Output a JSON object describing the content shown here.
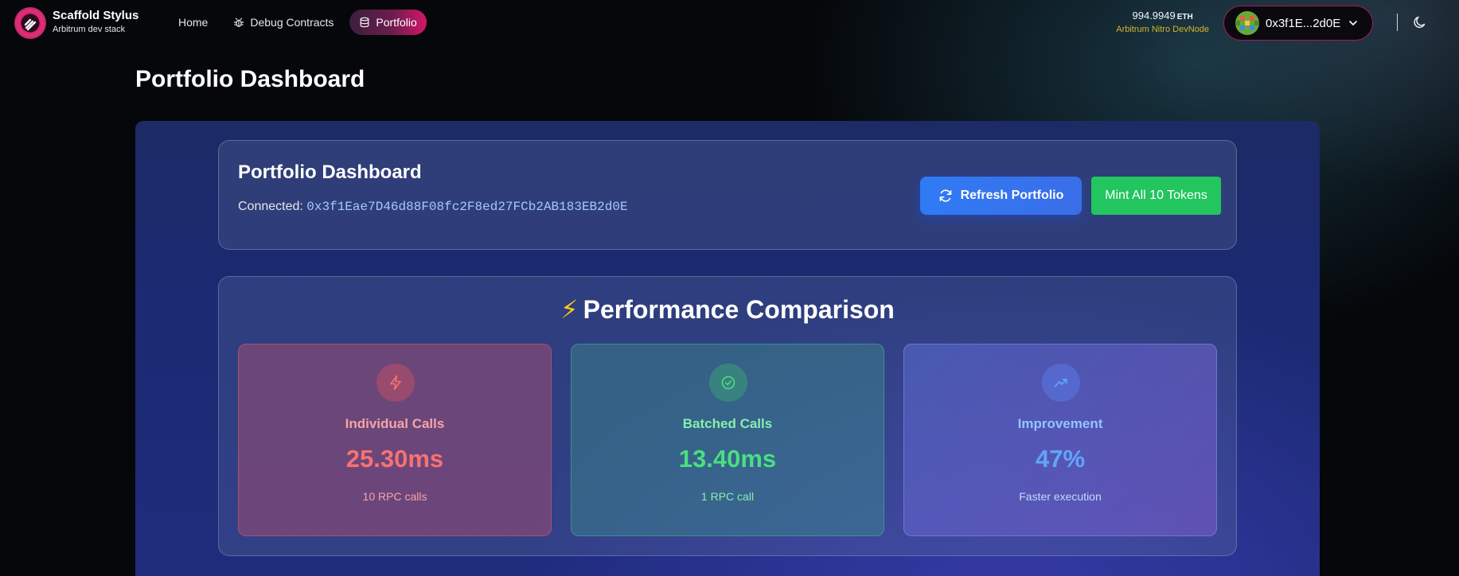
{
  "brand": {
    "title": "Scaffold Stylus",
    "subtitle": "Arbitrum dev stack"
  },
  "nav": [
    {
      "label": "Home",
      "icon": "none"
    },
    {
      "label": "Debug Contracts",
      "icon": "bug-icon"
    },
    {
      "label": "Portfolio",
      "icon": "database-icon",
      "active": true
    }
  ],
  "wallet": {
    "balance": "994.9949",
    "unit": "ETH",
    "network": "Arbitrum Nitro DevNode",
    "address_short": "0x3f1E...2d0E"
  },
  "page": {
    "title": "Portfolio Dashboard"
  },
  "dashboard": {
    "title": "Portfolio Dashboard",
    "connected_label": "Connected:",
    "connected_address": "0x3f1Eae7D46d88F08fc2F8ed27FCb2AB183EB2d0E",
    "refresh_label": "Refresh Portfolio",
    "mint_label": "Mint All 10 Tokens"
  },
  "performance": {
    "icon": "⚡",
    "title": "Performance Comparison",
    "metrics": [
      {
        "label": "Individual Calls",
        "value": "25.30ms",
        "note": "10 RPC calls",
        "icon": "lightning-icon",
        "color": "#f87171"
      },
      {
        "label": "Batched Calls",
        "value": "13.40ms",
        "note": "1 RPC call",
        "icon": "check-circle-icon",
        "color": "#4ade80"
      },
      {
        "label": "Improvement",
        "value": "47%",
        "note": "Faster execution",
        "icon": "trending-up-icon",
        "color": "#60a5fa"
      }
    ]
  },
  "colors": {
    "accent": "#d4166a",
    "primary_button": "#2f7bf5",
    "success_button": "#22c55e",
    "network_text": "#d4b32a"
  }
}
